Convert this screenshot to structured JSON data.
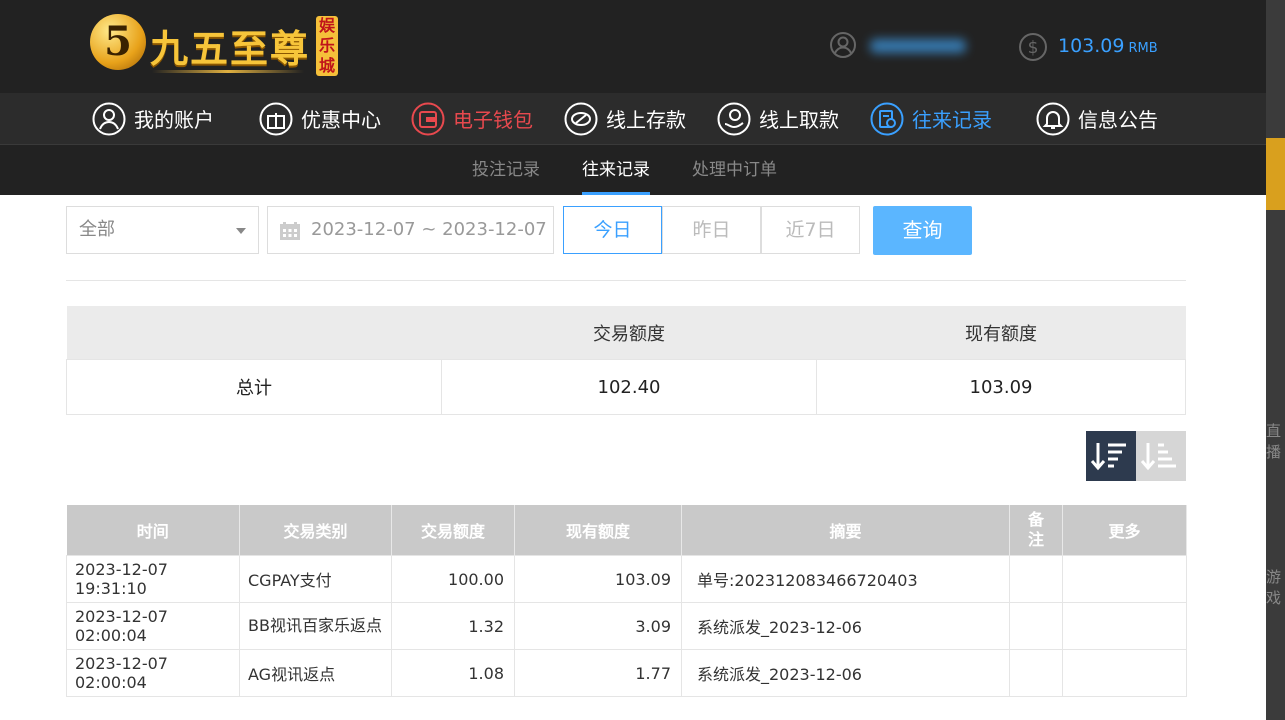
{
  "header": {
    "logo_text": "九五至尊",
    "logo_badge": "娱乐城",
    "logo_mark": "5",
    "balance_value": "103.09",
    "balance_unit": "RMB"
  },
  "main_nav": [
    {
      "label": "我的账户",
      "icon": "user-icon"
    },
    {
      "label": "优惠中心",
      "icon": "gift-icon"
    },
    {
      "label": "电子钱包",
      "icon": "wallet-icon"
    },
    {
      "label": "线上存款",
      "icon": "deposit-icon"
    },
    {
      "label": "线上取款",
      "icon": "withdraw-icon"
    },
    {
      "label": "往来记录",
      "icon": "record-icon"
    },
    {
      "label": "信息公告",
      "icon": "bell-icon"
    }
  ],
  "sub_nav": [
    "投注记录",
    "往来记录",
    "处理中订单"
  ],
  "filter": {
    "type_select": "全部",
    "date_range": "2023-12-07 ~ 2023-12-07",
    "quick_ranges": [
      "今日",
      "昨日",
      "近7日"
    ],
    "query_label": "查询"
  },
  "summary": {
    "headers": [
      "",
      "交易额度",
      "现有额度"
    ],
    "row_label": "总计",
    "trade_amount": "102.40",
    "current_amount": "103.09"
  },
  "records": {
    "headers": [
      "时间",
      "交易类别",
      "交易额度",
      "现有额度",
      "摘要",
      "备注",
      "更多"
    ],
    "rows": [
      {
        "time": "2023-12-07 19:31:10",
        "category": "CGPAY支付",
        "amount": "100.00",
        "balance": "103.09",
        "summary": "单号:202312083466720403",
        "note": "",
        "more": ""
      },
      {
        "time": "2023-12-07 02:00:04",
        "category": "BB视讯百家乐返点",
        "amount": "1.32",
        "balance": "3.09",
        "summary": "系统派发_2023-12-06",
        "note": "",
        "more": ""
      },
      {
        "time": "2023-12-07 02:00:04",
        "category": "AG视讯返点",
        "amount": "1.08",
        "balance": "1.77",
        "summary": "系统派发_2023-12-06",
        "note": "",
        "more": ""
      }
    ]
  },
  "edge_text": [
    "直播",
    "游戏"
  ],
  "colors": {
    "accent_blue": "#3aa0ff",
    "accent_red": "#e8494e",
    "header_bg": "#222222"
  }
}
